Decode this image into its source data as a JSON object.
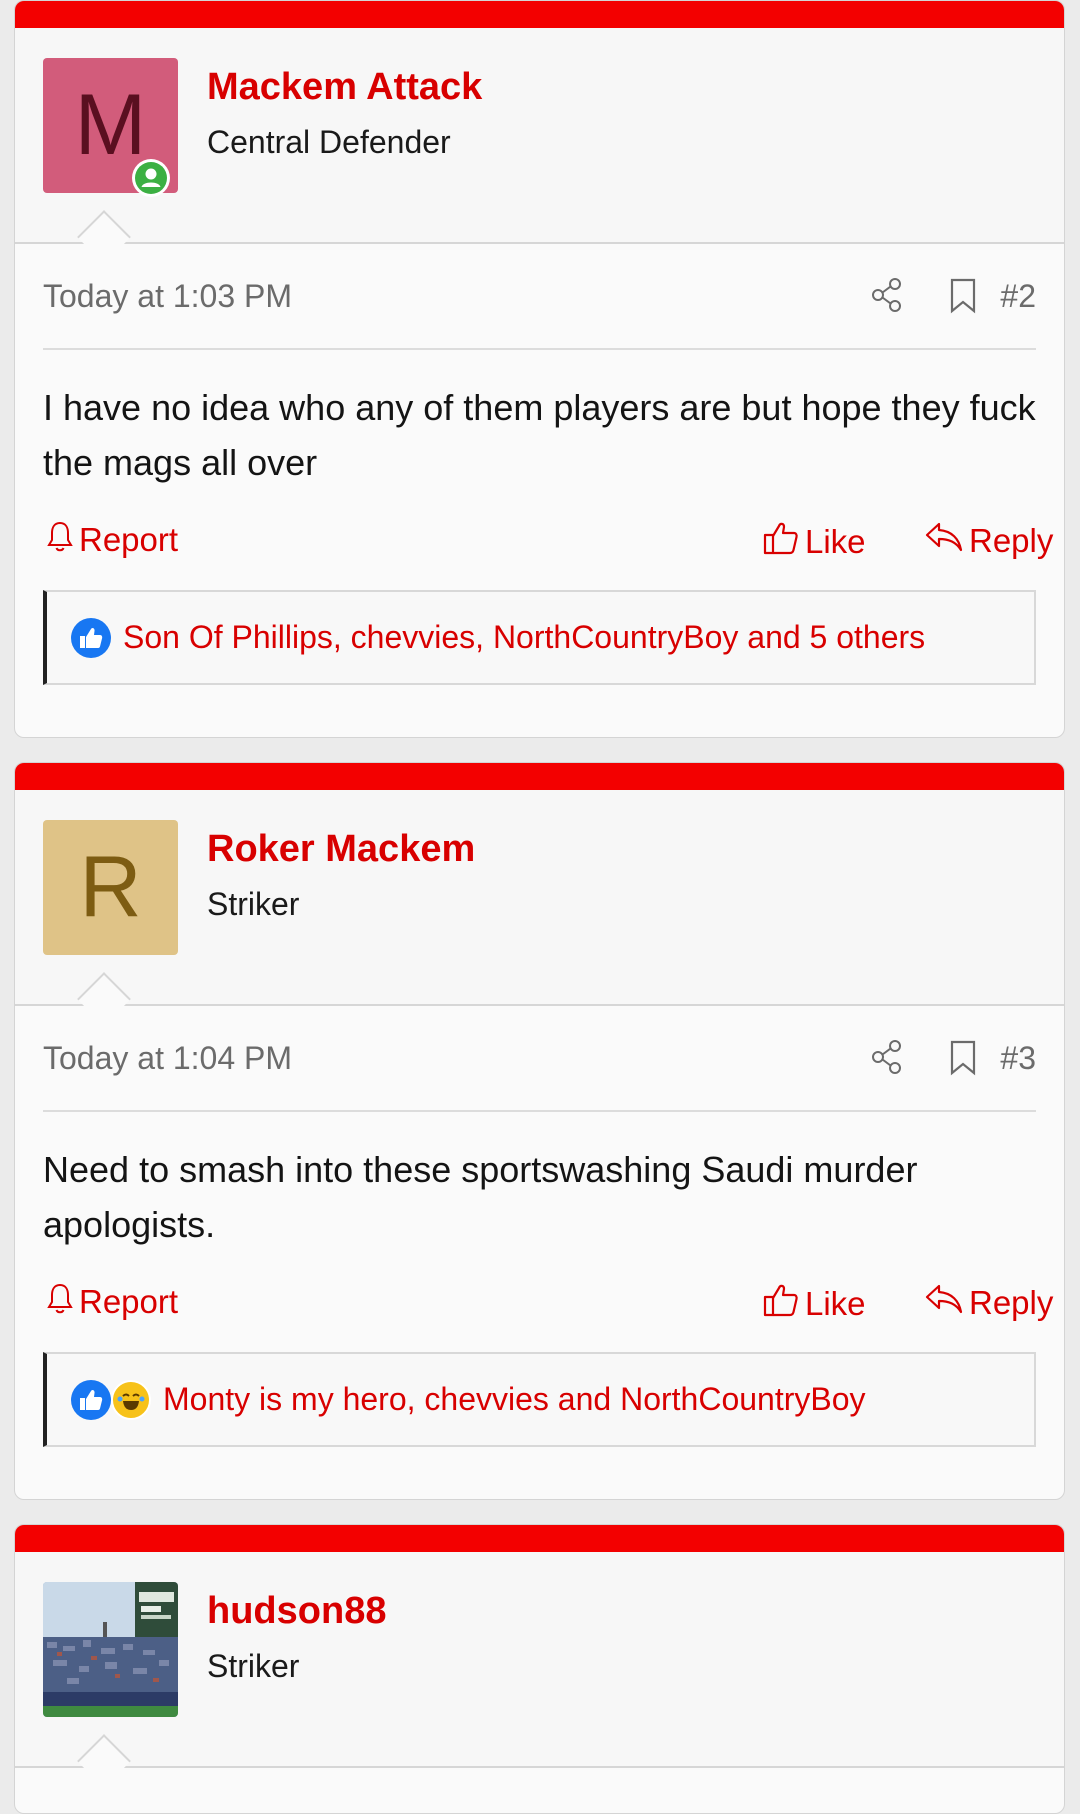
{
  "posts": [
    {
      "username": "Mackem Attack",
      "user_title": "Central Defender",
      "avatar_letter": "M",
      "avatar_bg": "#d25c7b",
      "avatar_fg": "#5a0f20",
      "online": true,
      "date": "Today at 1:03 PM",
      "number": "#2",
      "body": "I have no idea who any of them players are but hope they fuck the mags all over",
      "report_label": "Report",
      "like_label": "Like",
      "reply_label": "Reply",
      "reactions_text": "Son Of Phillips, chevvies, NorthCountryBoy and 5 others",
      "reaction_icons": [
        "like-icon"
      ]
    },
    {
      "username": "Roker Mackem",
      "user_title": "Striker",
      "avatar_letter": "R",
      "avatar_bg": "#dfc387",
      "avatar_fg": "#7d5c12",
      "online": false,
      "date": "Today at 1:04 PM",
      "number": "#3",
      "body": "Need to smash into these sportswashing Saudi murder apologists.",
      "report_label": "Report",
      "like_label": "Like",
      "reply_label": "Reply",
      "reactions_text": "Monty is my hero, chevvies and NorthCountryBoy",
      "reaction_icons": [
        "like-icon",
        "laugh-icon"
      ]
    },
    {
      "username": "hudson88",
      "user_title": "Striker",
      "avatar_image": "stadium-photo"
    }
  ],
  "colors": {
    "accent": "#d80000",
    "bar": "#f30000",
    "online": "#3cb043"
  }
}
